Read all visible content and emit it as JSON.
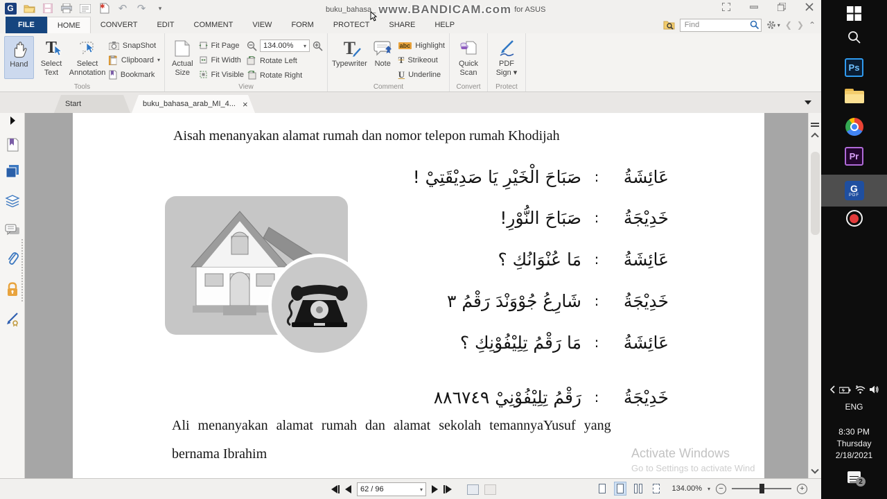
{
  "window": {
    "title_prefix": "buku_bahasa_",
    "watermark": "www.BANDICAM.com",
    "title_suffix": "for ASUS"
  },
  "menu": {
    "tabs": [
      "FILE",
      "HOME",
      "CONVERT",
      "EDIT",
      "COMMENT",
      "VIEW",
      "FORM",
      "PROTECT",
      "SHARE",
      "HELP"
    ]
  },
  "find": {
    "placeholder": "Find"
  },
  "ribbon": {
    "tools": {
      "label": "Tools",
      "hand": "Hand",
      "select_text": "Select Text",
      "select_annotation": "Select Annotation",
      "snapshot": "SnapShot",
      "clipboard": "Clipboard",
      "bookmark": "Bookmark"
    },
    "view": {
      "label": "View",
      "actual_size": "Actual Size",
      "fit_page": "Fit Page",
      "fit_width": "Fit Width",
      "fit_visible": "Fit Visible",
      "zoom_value": "134.00%",
      "rotate_left": "Rotate Left",
      "rotate_right": "Rotate Right"
    },
    "comment": {
      "label": "Comment",
      "typewriter": "Typewriter",
      "note": "Note",
      "highlight": "Highlight",
      "strikeout": "Strikeout",
      "underline": "Underline",
      "abc": "abc",
      "t_glyph": "T",
      "u_glyph": "U"
    },
    "convert": {
      "label": "Convert",
      "quick_scan": "Quick Scan"
    },
    "protect": {
      "label": "Protect",
      "pdf_sign": "PDF Sign"
    }
  },
  "doc_tabs": {
    "start": "Start",
    "document": "buku_bahasa_arab_MI_4...",
    "close": "×"
  },
  "page": {
    "heading": "Aisah menanyakan alamat rumah dan nomor telepon rumah Khodijah",
    "dialogue": [
      {
        "speaker": "عَائِشَةُ",
        "colon": ":",
        "text": "صَبَاحَ الْخَيْرِ  يَا صَدِيْقَتِيْ !"
      },
      {
        "speaker": "خَدِيْجَةُ",
        "colon": ":",
        "text": "صَبَاحَ النُّوْرِ!"
      },
      {
        "speaker": "عَائِشَةُ",
        "colon": ":",
        "text": "مَا عُنْوَانُكِ ؟"
      },
      {
        "speaker": "خَدِيْجَةُ",
        "colon": ":",
        "text": "شَارِعُ جُوْوَنْدَ رَقْمُ ٣"
      },
      {
        "speaker": "عَائِشَةُ",
        "colon": ":",
        "text": "مَا رَقْمُ تِلِيْفُوْنِكِ ؟"
      },
      {
        "speaker": "خَدِيْجَةُ",
        "colon": ":",
        "text": "رَقْمُ تِلِيْفُوْنِيْ ٨٨٦٧٤٩"
      }
    ],
    "paragraph_line1": "Ali menanyakan alamat rumah dan alamat sekolah temannyaYusuf yang",
    "paragraph_line2": "bernama Ibrahim",
    "activate_title": "Activate Windows",
    "activate_sub": "Go to Settings to activate Wind"
  },
  "statusbar": {
    "page_value": "62 / 96",
    "zoom_value": "134.00%"
  },
  "taskbar": {
    "ps": "Ps",
    "pr": "Pr",
    "foxit_g": "G",
    "foxit_pdf": "PDF",
    "language": "ENG",
    "time": "8:30 PM",
    "weekday": "Thursday",
    "date": "2/18/2021",
    "badge": "2"
  },
  "colors": {
    "file_tab_blue": "#16457f",
    "selected_tool_bg": "#ccd9ee",
    "doc_background_gray": "#a6a6a6",
    "taskbar_black": "#0d0d0d",
    "taskbar_highlight": "#4e4e4e",
    "record_red": "#e23b3b",
    "lock_orange": "#e8a33d",
    "highlight_yellow": "#e9a33c",
    "activate_gray": "#c2c2c2"
  }
}
